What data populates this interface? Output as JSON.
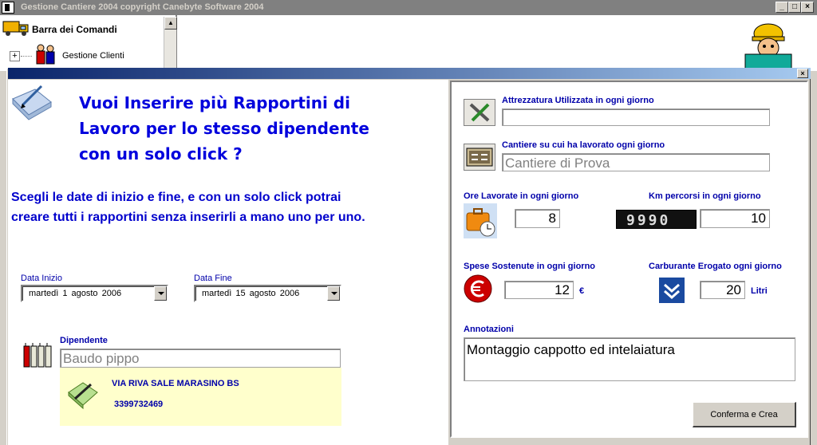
{
  "window": {
    "title": "Gestione Cantiere 2004    copyright Canebyte Software 2004",
    "min_glyph": "_",
    "max_glyph": "□",
    "close_glyph": "×"
  },
  "command_bar": {
    "title": "Barra dei Comandi",
    "tree_expander": "+",
    "items": [
      {
        "label": "Gestione Clienti"
      }
    ]
  },
  "dialog": {
    "close_glyph": "×",
    "headline_lines": [
      "Vuoi Inserire più Rapportini di",
      "Lavoro per lo stesso dipendente",
      "con un solo click ?"
    ],
    "description_lines": [
      "Scegli le date di inizio e fine, e con un solo click potrai",
      "creare tutti i rapportini senza inserirli a mano uno per uno."
    ],
    "start_date": {
      "label": "Data Inizio",
      "value": "martedì   1    agosto   2006"
    },
    "end_date": {
      "label": "Data Fine",
      "value": "martedì  15   agosto   2006"
    },
    "employee": {
      "label": "Dipendente",
      "value": "Baudo pippo",
      "address": "VIA RIVA SALE MARASINO BS",
      "phone": "3399732469"
    },
    "equipment": {
      "label": "Attrezzatura Utilizzata in ogni giorno",
      "value": ""
    },
    "site": {
      "label": "Cantiere su cui ha lavorato ogni giorno",
      "value": "Cantiere di Prova"
    },
    "hours": {
      "label": "Ore Lavorate in ogni giorno",
      "value": "8"
    },
    "km": {
      "label": "Km percorsi in ogni giorno",
      "value": "10",
      "odometer": "9990"
    },
    "expenses": {
      "label": "Spese Sostenute in ogni giorno",
      "value": "12",
      "unit": "€"
    },
    "fuel": {
      "label": "Carburante Erogato ogni giorno",
      "value": "20",
      "unit": "Litri"
    },
    "notes": {
      "label": "Annotazioni",
      "value": "Montaggio cappotto ed intelaiatura"
    },
    "confirm_label": "Conferma e Crea"
  },
  "colors": {
    "accent_blue": "#0000dd",
    "label_blue": "#0000aa",
    "info_bg": "#ffffcc",
    "dialog_bar": "#0a246a"
  }
}
